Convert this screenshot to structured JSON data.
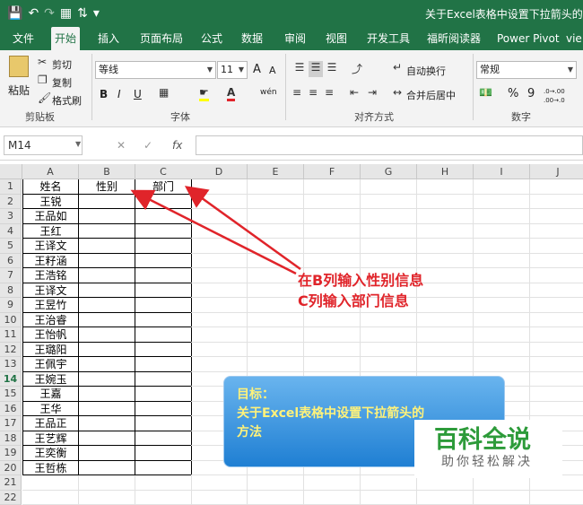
{
  "title_bar": {
    "quick_access": [
      "save-icon",
      "undo-icon",
      "redo-icon",
      "print-preview-icon",
      "sort-icon",
      "customize-icon"
    ],
    "doc_title": "关于Excel表格中设置下拉箭头的方法."
  },
  "tabs": [
    "文件",
    "开始",
    "插入",
    "页面布局",
    "公式",
    "数据",
    "审阅",
    "视图",
    "开发工具",
    "福昕阅读器",
    "Power Pivot",
    "vie"
  ],
  "ribbon": {
    "clipboard": {
      "paste": "粘贴",
      "cut": "剪切",
      "copy": "复制",
      "format_painter": "格式刷",
      "label": "剪贴板"
    },
    "font": {
      "name": "等线",
      "size": "11",
      "grow": "A",
      "shrink": "A",
      "bold": "B",
      "italic": "I",
      "underline": "U",
      "wen": "wén",
      "label": "字体"
    },
    "alignment": {
      "wrap": "自动换行",
      "merge": "合并后居中",
      "label": "对齐方式"
    },
    "number": {
      "format": "常规",
      "percent": "%",
      "comma": "9",
      "inc_dec": ".0→.00",
      "dec_dec": ".00→.0",
      "label": "数字"
    }
  },
  "formula_bar": {
    "name_box": "M14",
    "cancel": "✕",
    "enter": "✓",
    "fx": "fx",
    "value": ""
  },
  "columns": [
    "A",
    "B",
    "C",
    "D",
    "E",
    "F",
    "G",
    "H",
    "I",
    "J"
  ],
  "rows": [
    "1",
    "2",
    "3",
    "4",
    "5",
    "6",
    "7",
    "8",
    "9",
    "10",
    "11",
    "12",
    "13",
    "14",
    "15",
    "16",
    "17",
    "18",
    "19",
    "20",
    "21",
    "22"
  ],
  "selected_row": "14",
  "table": {
    "headers": [
      "姓名",
      "性别",
      "部门"
    ],
    "names": [
      "王锐",
      "王品如",
      "王红",
      "王译文",
      "王籽涵",
      "王浩铭",
      "王译文",
      "王昱竹",
      "王治睿",
      "王怡帆",
      "王璐阳",
      "王佩宇",
      "王婉玉",
      "王嘉",
      "王华",
      "王品正",
      "王艺辉",
      "王奕衡",
      "王哲栋"
    ]
  },
  "annotation": {
    "line1": "在B列输入性别信息",
    "line2": "C列输入部门信息"
  },
  "goal_box": {
    "label": "目标：",
    "text1": "关于Excel表格中设置下拉箭头的",
    "text2": "方法"
  },
  "watermark": {
    "title": "百科全说",
    "subtitle": "助你轻松解决"
  },
  "colors": {
    "excel_green": "#217346",
    "annotation_red": "#e0242a",
    "goal_text": "#fff27a"
  }
}
